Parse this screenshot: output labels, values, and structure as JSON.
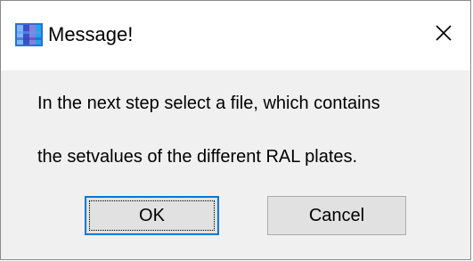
{
  "window": {
    "title": "Message!",
    "app_icon": "app-icon",
    "close_icon": "close-icon"
  },
  "message": {
    "line1": "In the next step select a file, which contains",
    "line2": "the setvalues of the different RAL plates."
  },
  "buttons": {
    "ok_label": "OK",
    "cancel_label": "Cancel"
  },
  "colors": {
    "focus_border": "#0078d7",
    "button_face": "#e1e1e1",
    "dialog_background": "#f0f0f0"
  }
}
